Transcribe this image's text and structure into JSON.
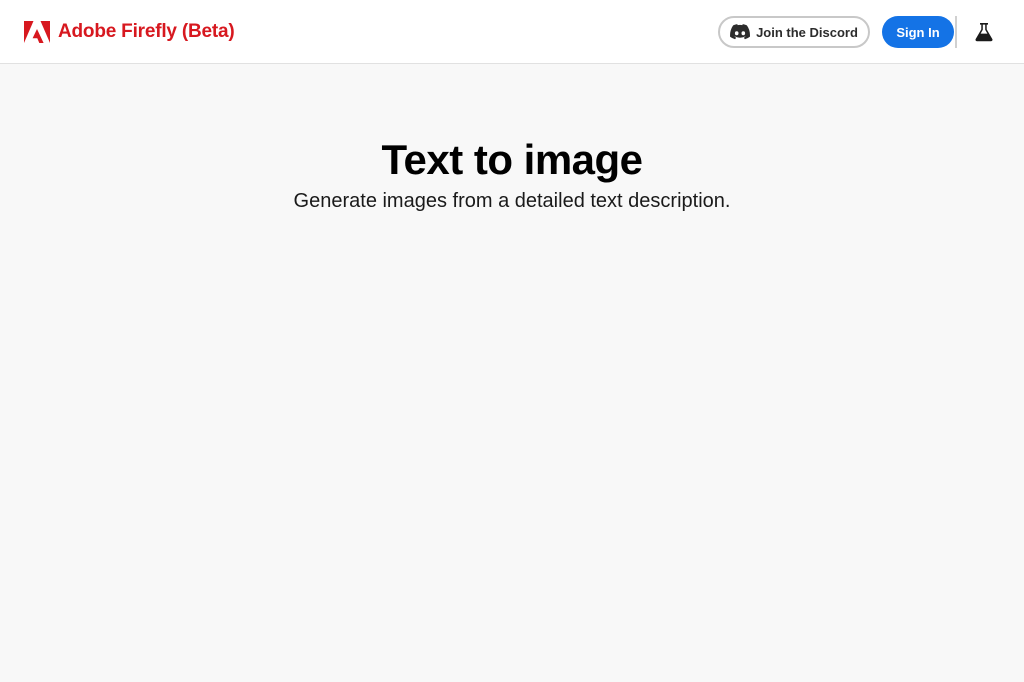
{
  "header": {
    "brand_name": "Adobe Firefly (Beta)",
    "brand_logo": "adobe-logo",
    "discord_label": "Join the Discord",
    "discord_icon": "discord-icon",
    "signin_label": "Sign In",
    "beta_icon": "flask-icon"
  },
  "hero": {
    "title": "Text to image",
    "subtitle": "Generate images from a detailed text description."
  },
  "colors": {
    "brand_red": "#d7181f",
    "primary_blue": "#1473e6",
    "page_background": "#f8f8f8",
    "header_background": "#ffffff"
  }
}
